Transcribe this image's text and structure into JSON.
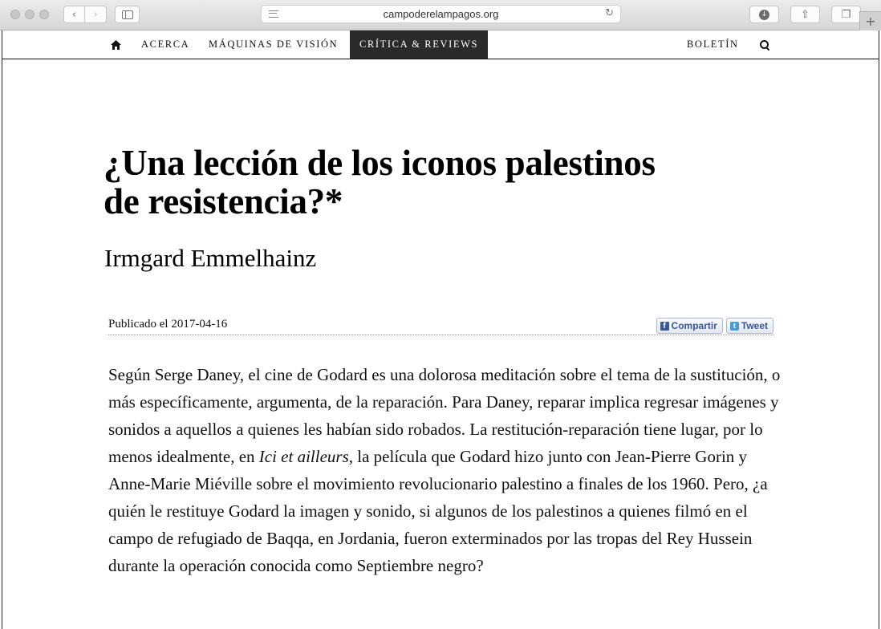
{
  "browser": {
    "url": "campoderelampagos.org"
  },
  "nav": {
    "about": "ACERCA",
    "vision_machines": "MÁQUINAS DE VISIÓN",
    "criticism": "CRÍTICA & REVIEWS",
    "newsletter": "BOLETÍN"
  },
  "article": {
    "title": "¿Una lección de los iconos palestinos de resistencia?*",
    "author": "Irmgard Emmelhainz",
    "published": "Publicado el 2017-04-16",
    "share_label": "Compartir",
    "tweet_label": "Tweet",
    "body_part1": "Según Serge Daney, el cine de Godard es una dolorosa meditación sobre el tema de la sustitución, o más específicamente, argumenta, de la reparación. Para Daney, reparar implica regresar imágenes y sonidos a aquellos a quienes les habían sido robados. La restitución-reparación tiene lugar, por lo menos idealmente, en ",
    "body_italic": "Ici et ailleurs",
    "body_part2": ", la película que Godard hizo junto con Jean-Pierre Gorin y Anne-Marie Miéville sobre el movimiento revolucionario palestino a finales de los 1960. Pero, ¿a quién le restituye Godard la imagen y sonido, si algunos de los palestinos a quienes filmó en el campo de refugiado de Baqqa, en Jordania, fueron exterminados por las tropas del Rey Hussein durante la operación conocida como Septiembre negro?"
  }
}
